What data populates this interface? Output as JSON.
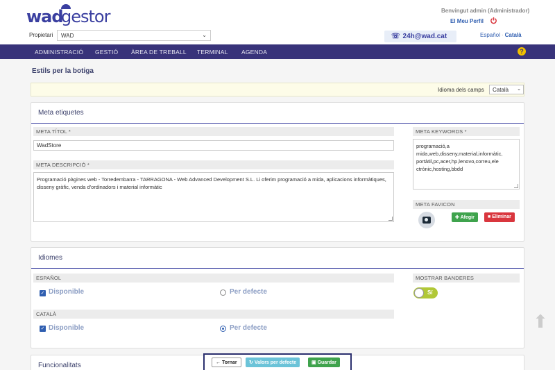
{
  "brand": {
    "logo_wad": "wad",
    "logo_gestor": "gestor"
  },
  "header": {
    "prop_label": "Propietari",
    "prop_value": "WAD",
    "welcome": "Benvingut admin (Administrador)",
    "profile_link": "El Meu Perfil",
    "support": "24h@wad.cat",
    "lang_es": "Español",
    "lang_ca": "Català"
  },
  "nav": {
    "items": [
      "ADMINISTRACIÓ",
      "GESTIÓ",
      "ÀREA DE TREBALL",
      "TERMINAL",
      "AGENDA"
    ],
    "help": "?"
  },
  "page": {
    "title": "Estils per la botiga"
  },
  "lang_bar": {
    "label": "Idioma dels camps",
    "value": "Català"
  },
  "meta": {
    "title": "Meta etiquetes",
    "meta_title_label": "META TÍTOL *",
    "meta_title_value": "WadStore",
    "meta_desc_label": "META DESCRIPCIÓ *",
    "meta_desc_value": "Programació pàgines web - Torredembarra - TARRAGONA - Web Advanced Development S.L. Li oferim programació a mida, aplicacions informàtiques, disseny gràfic, venda d'ordinadors i material informàtic",
    "keywords_label": "META KEYWORDS *",
    "keywords_value": "programació,a mida,web,disseny,material,informàtic, portàtil,pc,acer,hp,lenovo,correu,ele ctrònic,hosting,bbdd",
    "favicon_label": "META FAVICON",
    "add_label": "Afegir",
    "delete_label": "Eliminar"
  },
  "idiomes": {
    "title": "Idiomes",
    "es_label": "ESPAÑOL",
    "ca_label": "CATALÀ",
    "available_label": "Disponible",
    "default_label": "Per defecte",
    "flags_label": "MOSTRAR BANDERES",
    "flags_toggle": "Sí"
  },
  "func": {
    "title": "Funcionalitats"
  },
  "footer": {
    "back_label": "Tornar",
    "defaults_label": "Valors per defecte",
    "save_label": "Guardar"
  },
  "colors": {
    "nav": "#38337a",
    "accent": "#3a3fa0",
    "green": "#3fa34d",
    "red": "#d9363e",
    "toggle": "#b1c837"
  }
}
